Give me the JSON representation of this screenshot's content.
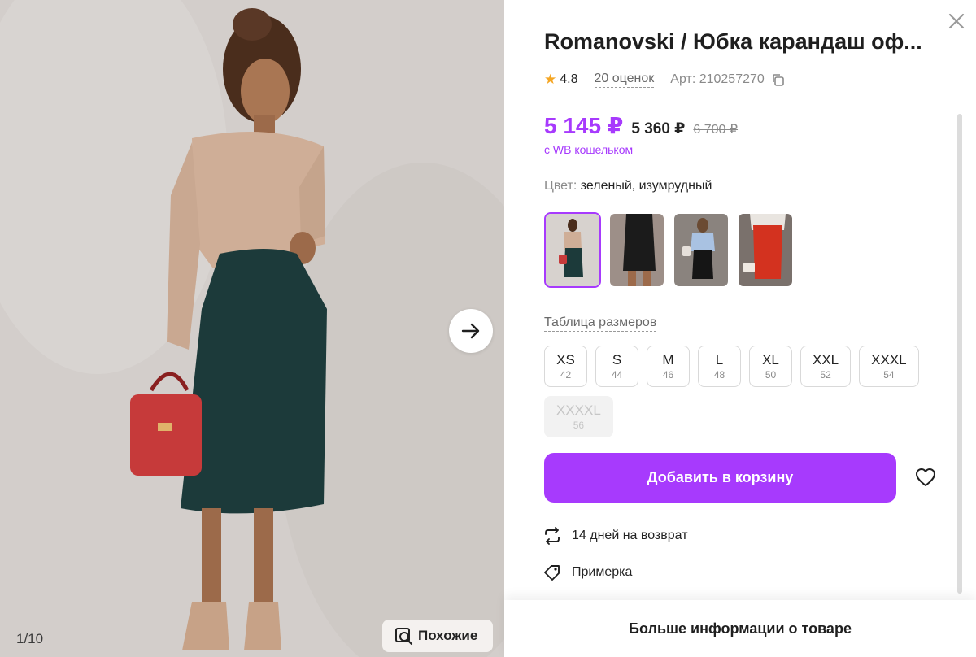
{
  "gallery": {
    "counter": "1/10",
    "similar_label": "Похожие",
    "next_icon": "arrow-right-icon",
    "similar_icon": "search-image-icon"
  },
  "product": {
    "title": "Romanovski / Юбка карандаш оф...",
    "rating": "4.8",
    "reviews": "20 оценок",
    "article": "Арт: 210257270",
    "price": {
      "wallet_price": "5 145 ₽",
      "price": "5 360 ₽",
      "old_price": "6 700 ₽",
      "wallet_note": "с WB кошельком"
    },
    "color": {
      "label": "Цвет:",
      "value": " зеленый, изумрудный"
    },
    "size_table_link": "Таблица размеров",
    "sizes": [
      {
        "size": "XS",
        "num": "42",
        "available": true
      },
      {
        "size": "S",
        "num": "44",
        "available": true
      },
      {
        "size": "M",
        "num": "46",
        "available": true
      },
      {
        "size": "L",
        "num": "48",
        "available": true
      },
      {
        "size": "XL",
        "num": "50",
        "available": true
      },
      {
        "size": "XXL",
        "num": "52",
        "available": true
      },
      {
        "size": "XXXL",
        "num": "54",
        "available": true
      },
      {
        "size": "XXXXL",
        "num": "56",
        "available": false
      }
    ],
    "add_to_cart": "Добавить в корзину",
    "features": [
      {
        "text": "14 дней на возврат",
        "icon": "return-arrows-icon"
      },
      {
        "text": "Примерка",
        "icon": "tag-icon"
      }
    ],
    "more_info": "Больше информации о товаре"
  },
  "colors": {
    "accent": "#a73afd",
    "star": "#f5a623",
    "skirt": "#1c3a3a"
  }
}
